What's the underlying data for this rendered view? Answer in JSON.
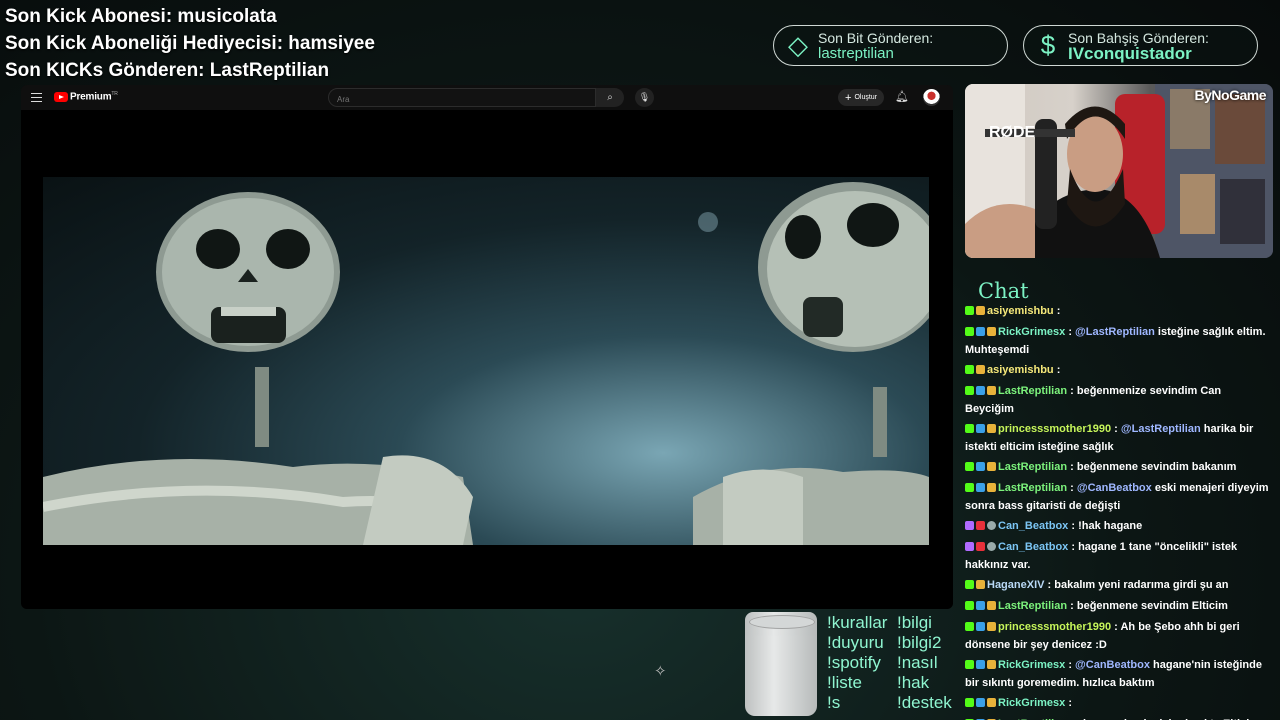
{
  "alerts": {
    "line1": "Son Kick Abonesi: musicolata",
    "line2": "Son Kick Aboneliği Hediyecisi: hamsiyee",
    "line3": "Son KICKs Gönderen: LastReptilian"
  },
  "pills": {
    "bit": {
      "icon": "diamond-icon",
      "label": "Son Bit Gönderen:",
      "value": "lastreptilian"
    },
    "bet": {
      "icon": "dollar-icon",
      "label": "Son Bahşiş Gönderen:",
      "value": "IVconquistador"
    }
  },
  "youtube": {
    "brand": "Premium",
    "brand_suffix": "TR",
    "search_placeholder": "Ara",
    "create_label": "Oluştur"
  },
  "webcam": {
    "brand": "ByNoGame",
    "mic_brand": "RØDE"
  },
  "chat": {
    "title": "Chat",
    "messages": [
      {
        "user": "asiyemishbu",
        "color": "#f5e87a",
        "text": " : ",
        "badges": [
          "k",
          "sub"
        ]
      },
      {
        "user": "RickGrimesx",
        "color": "#7cf2c4",
        "text": " : ",
        "mention": "@LastReptilian",
        "rest": " isteğine sağlık eltim. Muhteşemdi",
        "badges": [
          "k",
          "vip",
          "sub"
        ]
      },
      {
        "user": "asiyemishbu",
        "color": "#f5e87a",
        "text": " : ",
        "badges": [
          "k",
          "sub"
        ]
      },
      {
        "user": "LastReptilian",
        "color": "#7cf27c",
        "text": " : beğenmenize sevindim Can Beyciğim",
        "badges": [
          "k",
          "vip",
          "sub"
        ]
      },
      {
        "user": "princesssmother1990",
        "color": "#c6f55a",
        "text": " : ",
        "mention": "@LastReptilian",
        "rest": " harika bir istekti elticim isteğine sağlık",
        "badges": [
          "k",
          "vip",
          "sub"
        ]
      },
      {
        "user": "LastReptilian",
        "color": "#7cf27c",
        "text": " : beğenmene sevindim bakanım",
        "badges": [
          "k",
          "vip",
          "sub"
        ]
      },
      {
        "user": "LastReptilian",
        "color": "#7cf27c",
        "text": " : ",
        "mention": "@CanBeatbox",
        "rest": " eski menajeri diyeyim sonra bass gitaristi de değişti",
        "badges": [
          "k",
          "vip",
          "sub"
        ]
      },
      {
        "user": "Can_Beatbox",
        "color": "#7cc6f5",
        "text": " : !hak hagane",
        "badges": [
          "mod",
          "red",
          "gray"
        ]
      },
      {
        "user": "Can_Beatbox",
        "color": "#7cc6f5",
        "text": " : hagane 1 tane \"öncelikli\" istek hakkınız var.",
        "badges": [
          "mod",
          "red",
          "gray"
        ]
      },
      {
        "user": "HaganeXIV",
        "color": "#b8d8f5",
        "text": " : bakalım yeni radarıma girdi şu an",
        "badges": [
          "k",
          "sub"
        ]
      },
      {
        "user": "LastReptilian",
        "color": "#7cf27c",
        "text": " : beğenmene sevindim Elticim",
        "badges": [
          "k",
          "vip",
          "sub"
        ]
      },
      {
        "user": "princesssmother1990",
        "color": "#c6f55a",
        "text": " : Ah be Şebo ahh bi geri dönsene bir şey denicez :D",
        "badges": [
          "k",
          "vip",
          "sub"
        ]
      },
      {
        "user": "RickGrimesx",
        "color": "#7cf2c4",
        "text": " : ",
        "mention": "@CanBeatbox",
        "rest": " hagane'nin isteğinde bir sıkıntı goremedim. hızlıca baktım",
        "badges": [
          "k",
          "vip",
          "sub"
        ]
      },
      {
        "user": "RickGrimesx",
        "color": "#7cf2c4",
        "text": " : ",
        "badges": [
          "k",
          "vip",
          "sub"
        ]
      },
      {
        "user": "LastReptilian",
        "color": "#7cf27c",
        "text": " : ah yaa o benim içimde ukte Elticim",
        "badges": [
          "k",
          "vip",
          "sub"
        ]
      }
    ]
  },
  "commands": {
    "col1": [
      "!kurallar",
      "!duyuru",
      "!spotify",
      "!liste",
      "!s"
    ],
    "col2": [
      "!bilgi",
      "!bilgi2",
      "!nasıl",
      "!hak",
      "!destek"
    ]
  }
}
